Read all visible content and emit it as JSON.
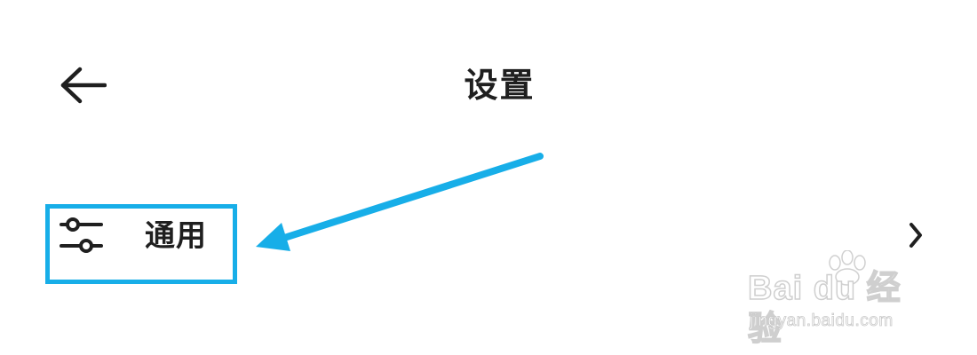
{
  "header": {
    "title": "设置",
    "back_icon": "arrow-left-icon"
  },
  "settings": {
    "items": [
      {
        "label": "通用",
        "icon": "sliders-icon",
        "trailing_icon": "chevron-right-icon"
      }
    ]
  },
  "annotation": {
    "highlight_color": "#17aee8",
    "arrow_color": "#17aee8"
  },
  "watermark": {
    "logo_text": "Bai du 经验",
    "url": "jingyan.baidu.com"
  }
}
